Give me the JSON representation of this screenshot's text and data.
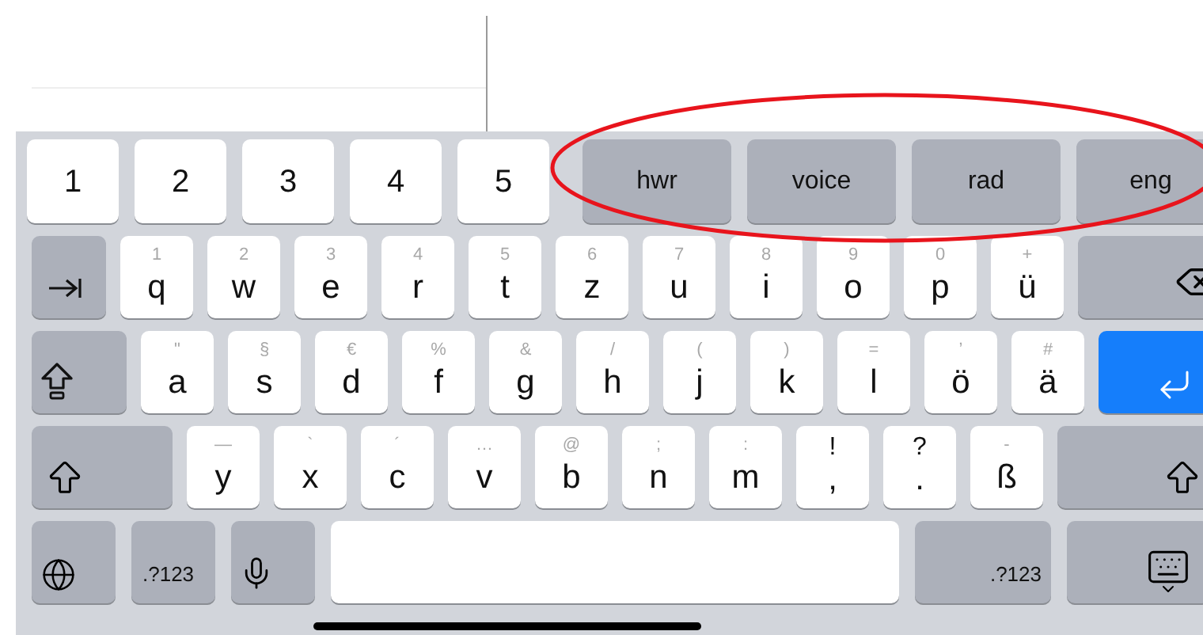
{
  "number_row": [
    {
      "label": "1"
    },
    {
      "label": "2"
    },
    {
      "label": "3"
    },
    {
      "label": "4"
    },
    {
      "label": "5"
    }
  ],
  "suggestions": [
    {
      "label": "hwr"
    },
    {
      "label": "voice"
    },
    {
      "label": "rad"
    },
    {
      "label": "eng"
    }
  ],
  "rows": [
    {
      "keys": [
        {
          "kind": "tab"
        },
        {
          "kind": "letter",
          "main": "q",
          "alt": "1"
        },
        {
          "kind": "letter",
          "main": "w",
          "alt": "2"
        },
        {
          "kind": "letter",
          "main": "e",
          "alt": "3"
        },
        {
          "kind": "letter",
          "main": "r",
          "alt": "4"
        },
        {
          "kind": "letter",
          "main": "t",
          "alt": "5"
        },
        {
          "kind": "letter",
          "main": "z",
          "alt": "6"
        },
        {
          "kind": "letter",
          "main": "u",
          "alt": "7"
        },
        {
          "kind": "letter",
          "main": "i",
          "alt": "8"
        },
        {
          "kind": "letter",
          "main": "o",
          "alt": "9"
        },
        {
          "kind": "letter",
          "main": "p",
          "alt": "0"
        },
        {
          "kind": "letter",
          "main": "ü",
          "alt": "+"
        },
        {
          "kind": "backspace"
        }
      ]
    },
    {
      "keys": [
        {
          "kind": "capslock"
        },
        {
          "kind": "letter",
          "main": "a",
          "alt": "\""
        },
        {
          "kind": "letter",
          "main": "s",
          "alt": "§"
        },
        {
          "kind": "letter",
          "main": "d",
          "alt": "€"
        },
        {
          "kind": "letter",
          "main": "f",
          "alt": "%"
        },
        {
          "kind": "letter",
          "main": "g",
          "alt": "&"
        },
        {
          "kind": "letter",
          "main": "h",
          "alt": "/"
        },
        {
          "kind": "letter",
          "main": "j",
          "alt": "("
        },
        {
          "kind": "letter",
          "main": "k",
          "alt": ")"
        },
        {
          "kind": "letter",
          "main": "l",
          "alt": "="
        },
        {
          "kind": "letter",
          "main": "ö",
          "alt": "’"
        },
        {
          "kind": "letter",
          "main": "ä",
          "alt": "#"
        },
        {
          "kind": "return"
        }
      ]
    },
    {
      "keys": [
        {
          "kind": "shift"
        },
        {
          "kind": "letter",
          "main": "y",
          "alt": "—"
        },
        {
          "kind": "letter",
          "main": "x",
          "alt": "`"
        },
        {
          "kind": "letter",
          "main": "c",
          "alt": "´"
        },
        {
          "kind": "letter",
          "main": "v",
          "alt": "…"
        },
        {
          "kind": "letter",
          "main": "b",
          "alt": "@"
        },
        {
          "kind": "letter",
          "main": "n",
          "alt": ";"
        },
        {
          "kind": "letter",
          "main": "m",
          "alt": ":"
        },
        {
          "kind": "letter",
          "main": ",",
          "alt": "!",
          "strong_alt": true
        },
        {
          "kind": "letter",
          "main": ".",
          "alt": "?",
          "strong_alt": true
        },
        {
          "kind": "letter",
          "main": "ß",
          "alt": "-"
        },
        {
          "kind": "shift"
        }
      ]
    },
    {
      "keys": [
        {
          "kind": "globe"
        },
        {
          "kind": "mode",
          "label": ".?123"
        },
        {
          "kind": "mic"
        },
        {
          "kind": "space"
        },
        {
          "kind": "mode",
          "label": ".?123"
        },
        {
          "kind": "hide"
        }
      ]
    }
  ]
}
